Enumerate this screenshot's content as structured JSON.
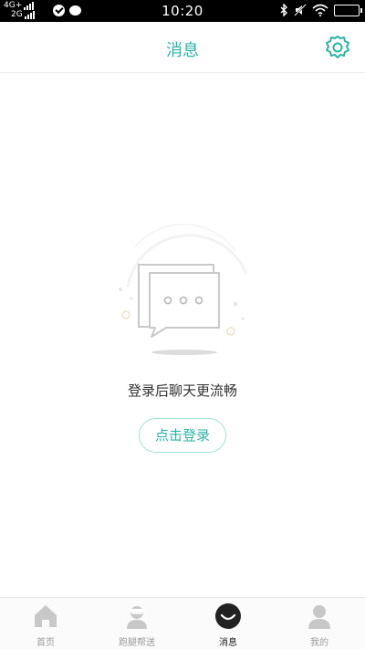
{
  "status_bar": {
    "network_top": "4G+",
    "network_bottom": "2G",
    "time": "10:20"
  },
  "header": {
    "title": "消息"
  },
  "empty_state": {
    "message": "登录后聊天更流畅",
    "login_label": "点击登录"
  },
  "tabs": [
    {
      "label": "首页",
      "icon": "home-icon",
      "active": false
    },
    {
      "label": "跑腿帮送",
      "icon": "courier-icon",
      "active": false
    },
    {
      "label": "消息",
      "icon": "message-icon",
      "active": true
    },
    {
      "label": "我的",
      "icon": "profile-icon",
      "active": false
    }
  ],
  "colors": {
    "accent": "#2bb5a6",
    "status_bar_bg": "#000000",
    "tab_inactive": "#c8c8c8",
    "tab_active": "#222222"
  }
}
